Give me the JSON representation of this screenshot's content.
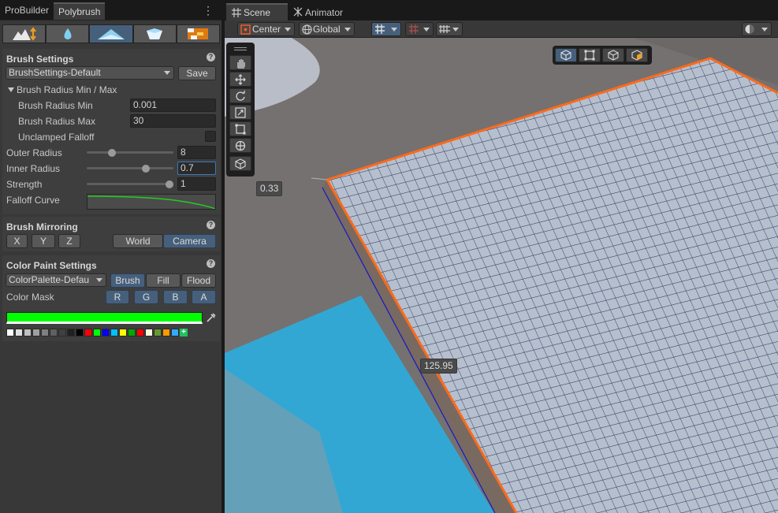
{
  "left_panel": {
    "tabs": [
      "ProBuilder",
      "Polybrush"
    ],
    "active_tab": "Polybrush",
    "mode_icons": [
      "sculpt-icon",
      "smooth-icon",
      "paint-vertex-color-icon",
      "scatter-prefab-icon",
      "paint-texture-icon"
    ],
    "brush_settings": {
      "title": "Brush Settings",
      "preset": "BrushSettings-Default",
      "save_label": "Save",
      "radius_foldout": "Brush Radius Min / Max",
      "radius_min_label": "Brush Radius Min",
      "radius_min_value": "0.001",
      "radius_max_label": "Brush Radius Max",
      "radius_max_value": "30",
      "unclamped_label": "Unclamped Falloff",
      "unclamped_checked": false,
      "outer_radius_label": "Outer Radius",
      "outer_radius_value": "8",
      "inner_radius_label": "Inner Radius",
      "inner_radius_value": "0.7",
      "strength_label": "Strength",
      "strength_value": "1",
      "falloff_label": "Falloff Curve"
    },
    "brush_mirroring": {
      "title": "Brush Mirroring",
      "axes": [
        "X",
        "Y",
        "Z"
      ],
      "space_options": [
        "World",
        "Camera"
      ],
      "active_space": "Camera"
    },
    "color_paint": {
      "title": "Color Paint Settings",
      "palette": "ColorPalette-Defau",
      "modes": [
        "Brush",
        "Fill",
        "Flood"
      ],
      "active_mode": "Brush",
      "color_mask_label": "Color Mask",
      "channels": [
        "R",
        "G",
        "B",
        "A"
      ],
      "current_color": "#00ff00",
      "swatches": [
        "#ffffff",
        "#e0e0e0",
        "#c0c0c0",
        "#a0a0a0",
        "#808080",
        "#606060",
        "#404040",
        "#202020",
        "#000000",
        "#ff0000",
        "#00ff00",
        "#0000ff",
        "#00c0ff",
        "#ffff00",
        "#00aa00",
        "#ff0000",
        "#fff8e0",
        "#669933",
        "#ff9900",
        "#33aaff"
      ]
    }
  },
  "scene_panel": {
    "tabs": [
      "Scene",
      "Animator"
    ],
    "active_tab": "Scene",
    "pivot_mode": "Center",
    "pivot_rotation": "Global",
    "measure_labels": [
      "0.33",
      "125.95"
    ],
    "colors": {
      "selection_outline": "#ff6a1a",
      "water": "#33a7d3",
      "grid_face": "#b6bfcd"
    }
  }
}
